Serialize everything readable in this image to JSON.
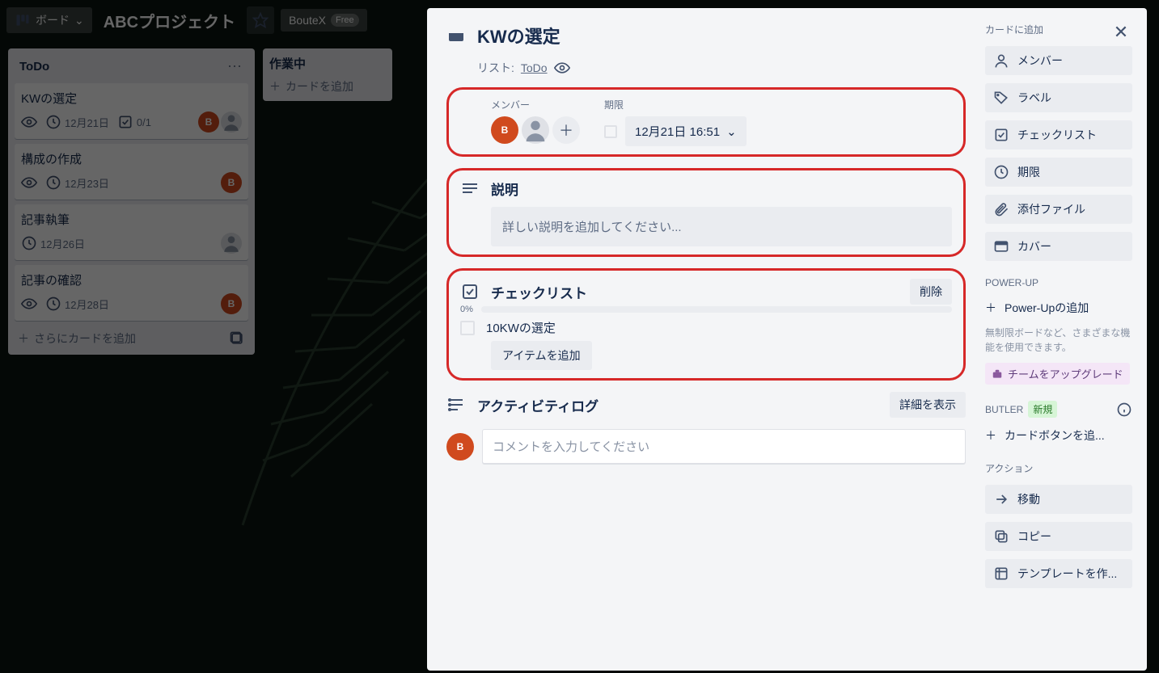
{
  "topbar": {
    "board_btn": "ボード",
    "title": "ABCプロジェクト",
    "chip1": "BouteX",
    "chip1_badge": "Free"
  },
  "lists": [
    {
      "title": "ToDo",
      "cards": [
        {
          "title": "KWの選定",
          "due": "12月21日",
          "check": "0/1",
          "avatars": [
            "B",
            ""
          ]
        },
        {
          "title": "構成の作成",
          "due": "12月23日",
          "check": null,
          "avatars": [
            "B"
          ]
        },
        {
          "title": "記事執筆",
          "due": "12月26日",
          "check": null,
          "avatars": [
            ""
          ]
        },
        {
          "title": "記事の確認",
          "due": "12月28日",
          "check": null,
          "avatars": [
            "B"
          ]
        }
      ],
      "add_label": "さらにカードを追加"
    },
    {
      "title": "作業中",
      "add_label": "カードを追加"
    }
  ],
  "modal": {
    "title": "KWの選定",
    "list_prefix": "リスト:",
    "list_name": "ToDo",
    "members_label": "メンバー",
    "due_label": "期限",
    "due_value": "12月21日 16:51",
    "desc_heading": "説明",
    "desc_placeholder": "詳しい説明を追加してください...",
    "checklist_heading": "チェックリスト",
    "checklist_delete": "削除",
    "checklist_progress": "0%",
    "checklist_items": [
      {
        "text": "10KWの選定"
      }
    ],
    "checklist_add": "アイテムを追加",
    "activity_heading": "アクティビティログ",
    "activity_detail": "詳細を表示",
    "comment_placeholder": "コメントを入力してください"
  },
  "side": {
    "add_heading": "カードに追加",
    "buttons": {
      "members": "メンバー",
      "labels": "ラベル",
      "checklist": "チェックリスト",
      "due": "期限",
      "attachment": "添付ファイル",
      "cover": "カバー"
    },
    "powerup_heading": "POWER-UP",
    "powerup_add": "Power-Upの追加",
    "powerup_note": "無制限ボードなど、さまざまな機能を使用できます。",
    "upgrade": "チームをアップグレード",
    "butler_heading": "BUTLER",
    "butler_new": "新規",
    "butler_add": "カードボタンを追...",
    "action_heading": "アクション",
    "move": "移動",
    "copy": "コピー",
    "template": "テンプレートを作..."
  }
}
